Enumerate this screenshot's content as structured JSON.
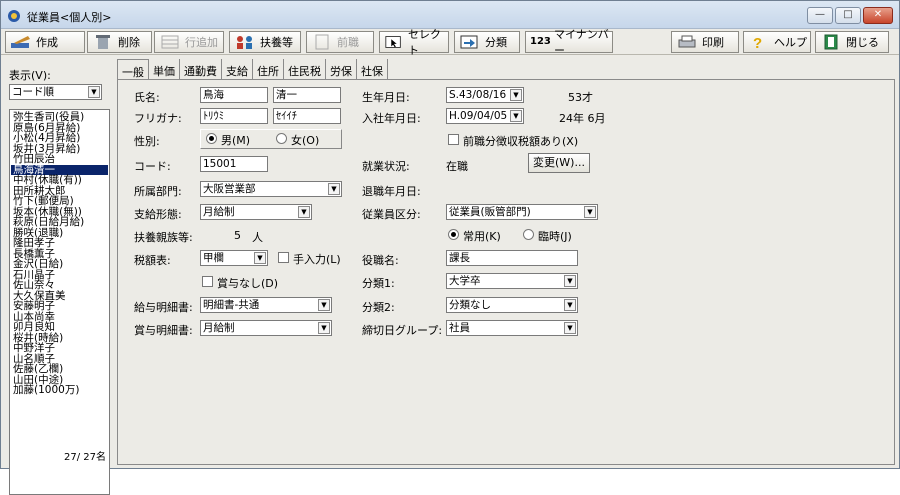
{
  "window": {
    "title": "従業員<個人別>"
  },
  "toolbar": {
    "create": "作成",
    "delete": "削除",
    "add_row": "行追加",
    "dependents": "扶養等",
    "previous_job": "前職",
    "select": "セレクト",
    "classify": "分類",
    "my_number": "マイナンバー",
    "my_number_prefix": "123",
    "print": "印刷",
    "help": "ヘルプ",
    "close": "閉じる"
  },
  "sidebar": {
    "display_label": "表示(V):",
    "sort_value": "コード順",
    "employees": [
      "弥生香司(役員)",
      "原島(6月昇給)",
      "小松(4月昇給)",
      "坂井(3月昇給)",
      "竹田辰治",
      "鳥海清一",
      "中村(休職(有))",
      "田所耕太郎",
      "竹下(郵便局)",
      "坂本(休職(無))",
      "萩原(日給月給)",
      "勝咲(退職)",
      "隆田孝子",
      "長橋薫子",
      "金沢(日給)",
      "石川晶子",
      "佐山奈々",
      "大久保直美",
      "安藤明子",
      "山本尚幸",
      "卯月良知",
      "桜井(時給)",
      "中野洋子",
      "山名順子",
      "佐藤(乙欄)",
      "山田(中途)",
      "加藤(1000万)"
    ],
    "selected_index": 5,
    "count": "27/ 27名"
  },
  "tabs": [
    "一般",
    "単価",
    "通勤費",
    "支給",
    "住所",
    "住民税",
    "労保",
    "社保"
  ],
  "form": {
    "name_label": "氏名:",
    "last_name": "鳥海",
    "first_name": "清一",
    "kana_label": "フリガナ:",
    "last_kana": "ﾄﾘｳﾐ",
    "first_kana": "ｾｲｲﾁ",
    "gender_label": "性別:",
    "male": "男(M)",
    "female": "女(O)",
    "code_label": "コード:",
    "code": "15001",
    "dept_label": "所属部門:",
    "dept": "大阪営業部",
    "pay_form_label": "支給形態:",
    "pay_form": "月給制",
    "dependents_label": "扶養親族等:",
    "dependents_value": "5",
    "dependents_unit": "人",
    "tax_table_label": "税額表:",
    "tax_table": "甲欄",
    "manual_input": "手入力(L)",
    "no_bonus": "賞与なし(D)",
    "payslip_label": "給与明細書:",
    "payslip": "明細書-共通",
    "bonus_slip_label": "賞与明細書:",
    "bonus_slip": "月給制",
    "birth_label": "生年月日:",
    "birth": "S.43/08/16",
    "age": "53才",
    "hire_label": "入社年月日:",
    "hire": "H.09/04/05",
    "tenure": "24年 6月",
    "prev_tax": "前職分徴収税額あり(X)",
    "status_label": "就業状況:",
    "status": "在職",
    "change_button": "変更(W)...",
    "retire_label": "退職年月日:",
    "emp_class_label": "従業員区分:",
    "emp_class": "従業員(販管部門)",
    "regular": "常用(K)",
    "temporary": "臨時(J)",
    "title_label": "役職名:",
    "title": "課長",
    "class1_label": "分類1:",
    "class1": "大学卒",
    "class2_label": "分類2:",
    "class2": "分類なし",
    "closing_label": "締切日グループ:",
    "closing": "社員"
  }
}
